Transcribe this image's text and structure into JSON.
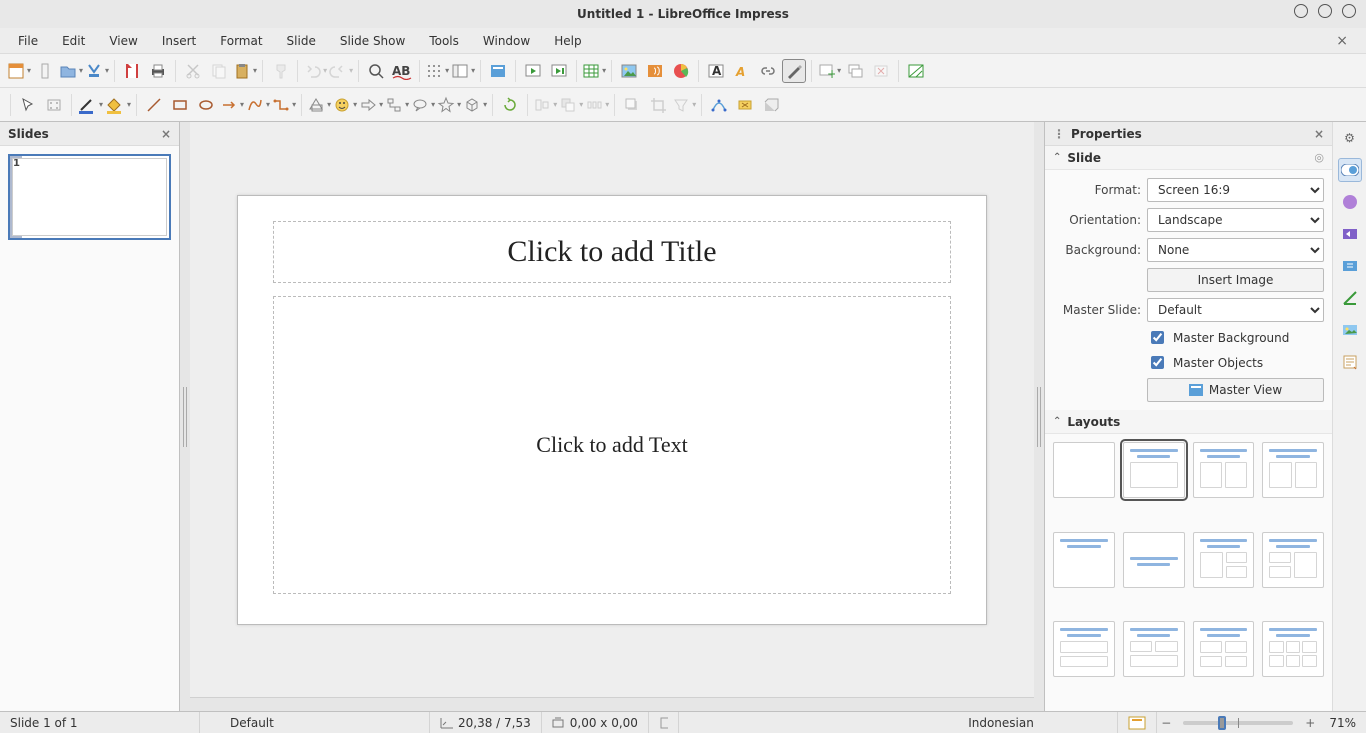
{
  "window": {
    "title": "Untitled 1 - LibreOffice Impress"
  },
  "menu": [
    "File",
    "Edit",
    "View",
    "Insert",
    "Format",
    "Slide",
    "Slide Show",
    "Tools",
    "Window",
    "Help"
  ],
  "panels": {
    "slides": {
      "title": "Slides",
      "thumb_number": "1"
    },
    "properties": {
      "title": "Properties"
    }
  },
  "editor": {
    "title_placeholder": "Click to add Title",
    "text_placeholder": "Click to add Text"
  },
  "props": {
    "slide_section": "Slide",
    "format": {
      "label": "Format:",
      "value": "Screen 16:9"
    },
    "orientation": {
      "label": "Orientation:",
      "value": "Landscape"
    },
    "background": {
      "label": "Background:",
      "value": "None"
    },
    "insert_image": "Insert Image",
    "master_slide": {
      "label": "Master Slide:",
      "value": "Default"
    },
    "master_bg": "Master Background",
    "master_obj": "Master Objects",
    "master_view": "Master View",
    "layouts_section": "Layouts"
  },
  "status": {
    "slide": "Slide 1 of 1",
    "template": "Default",
    "pos": "20,38 / 7,53",
    "size": "0,00 x 0,00",
    "lang": "Indonesian",
    "zoom": "71%"
  }
}
